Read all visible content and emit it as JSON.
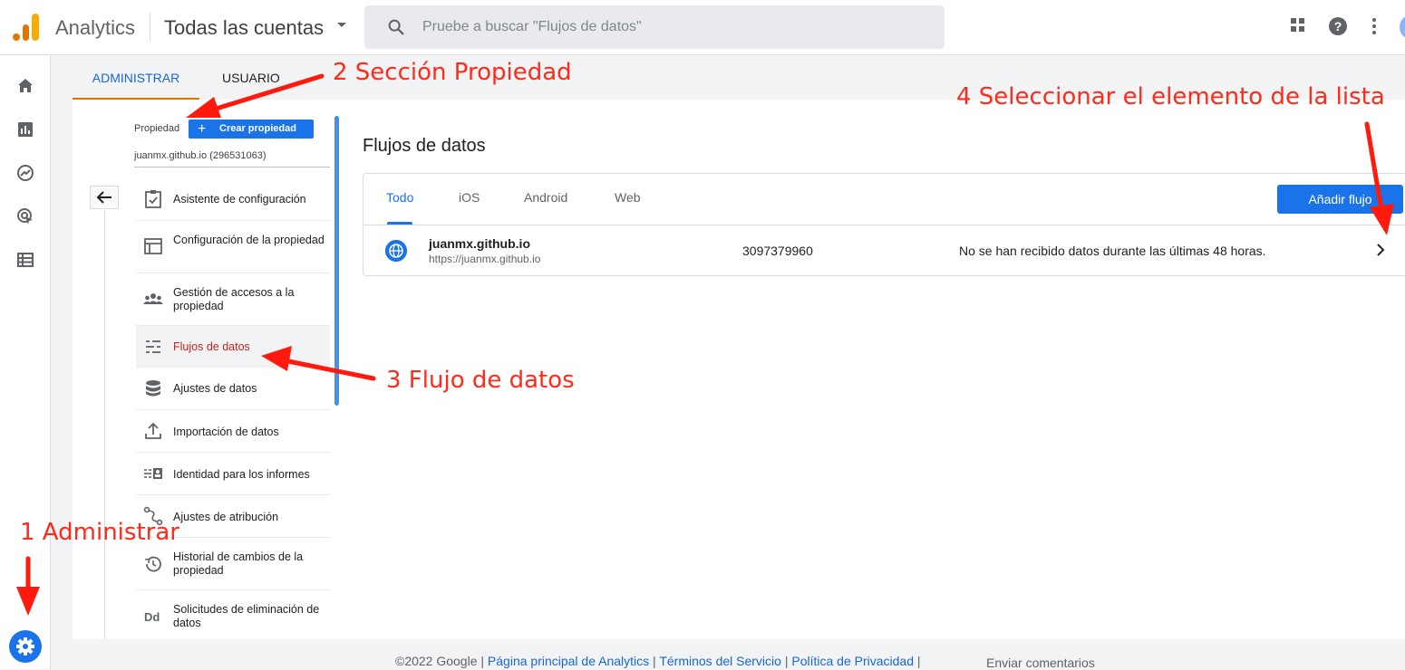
{
  "header": {
    "app_title": "Analytics",
    "account": "Todas las cuentas",
    "search_placeholder": "Pruebe a buscar \"Flujos de datos\""
  },
  "admin_tabs": {
    "admin": "ADMINISTRAR",
    "user": "USUARIO"
  },
  "property": {
    "label": "Propiedad",
    "create_label": "Crear propiedad",
    "name": "juanmx.github.io (296531063)"
  },
  "menu": [
    {
      "label": "Asistente de configuración",
      "icon": "checklist-icon"
    },
    {
      "label": "Configuración de la propiedad",
      "icon": "layout-icon"
    },
    {
      "label": "Gestión de accesos a la propiedad",
      "icon": "people-icon"
    },
    {
      "label": "Flujos de datos",
      "icon": "streams-icon",
      "active": true
    },
    {
      "label": "Ajustes de datos",
      "icon": "database-icon"
    },
    {
      "label": "Importación de datos",
      "icon": "upload-icon"
    },
    {
      "label": "Identidad para los informes",
      "icon": "identity-icon"
    },
    {
      "label": "Ajustes de atribución",
      "icon": "attribution-icon"
    },
    {
      "label": "Historial de cambios de la propiedad",
      "icon": "history-icon"
    },
    {
      "label": "Solicitudes de eliminación de datos",
      "icon": "dd-icon"
    }
  ],
  "main": {
    "title": "Flujos de datos",
    "tabs": [
      "Todo",
      "iOS",
      "Android",
      "Web"
    ],
    "add_button": "Añadir flujo",
    "stream": {
      "name": "juanmx.github.io",
      "url": "https://juanmx.github.io",
      "id": "3097379960",
      "status": "No se han recibido datos durante las últimas 48 horas."
    }
  },
  "footer": {
    "copyright": "©2022 Google",
    "link_home": "Página principal de Analytics",
    "link_terms": "Términos del Servicio",
    "link_privacy": "Política de Privacidad",
    "feedback": "Enviar comentarios"
  },
  "annotations": {
    "a1": "1 Administrar",
    "a2": "2 Sección Propiedad",
    "a3": "3 Flujo de datos",
    "a4": "4 Seleccionar el elemento de la lista"
  },
  "colors": {
    "accent": "#1a73e8",
    "annotation": "#ff2a1a",
    "active_menu": "#c5221f",
    "tab_underline": "#e37400"
  }
}
